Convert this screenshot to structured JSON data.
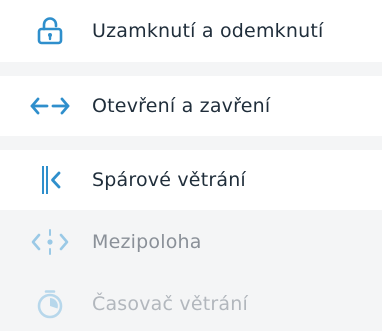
{
  "menu": {
    "items": [
      {
        "label": "Uzamknutí a odemknutí",
        "icon": "unlock-icon",
        "enabled": true
      },
      {
        "label": "Otevření a zavření",
        "icon": "open-close-arrows-icon",
        "enabled": true
      },
      {
        "label": "Spárové větrání",
        "icon": "gap-ventilation-icon",
        "enabled": true
      },
      {
        "label": "Mezipoloha",
        "icon": "intermediate-position-icon",
        "enabled": false
      },
      {
        "label": "Časovač větrání",
        "icon": "timer-icon",
        "enabled": false
      }
    ]
  },
  "colors": {
    "accent": "#2f8fcc",
    "text": "#1f2d3a",
    "disabled_text": "#8a9098",
    "disabled_icon": "#9ac9e6",
    "background": "#f4f5f6"
  }
}
